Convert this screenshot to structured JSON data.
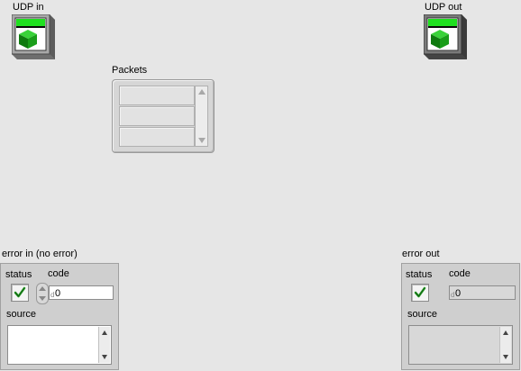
{
  "udp_in": {
    "label": "UDP in",
    "icon": "udp-refnum-icon"
  },
  "udp_out": {
    "label": "UDP out",
    "icon": "udp-refnum-icon"
  },
  "packets": {
    "label": "Packets",
    "visible_rows": 3
  },
  "error_in": {
    "label": "error in (no error)",
    "status_label": "status",
    "code_label": "code",
    "code_value": "0",
    "source_label": "source",
    "source_value": "",
    "status_icon": "checkmark-icon",
    "status_color": "#2e9e2e"
  },
  "error_out": {
    "label": "error out",
    "status_label": "status",
    "code_label": "code",
    "code_value": "0",
    "source_label": "source",
    "source_value": "",
    "status_icon": "checkmark-icon",
    "status_color": "#2e9e2e"
  },
  "radix_marker": "d"
}
